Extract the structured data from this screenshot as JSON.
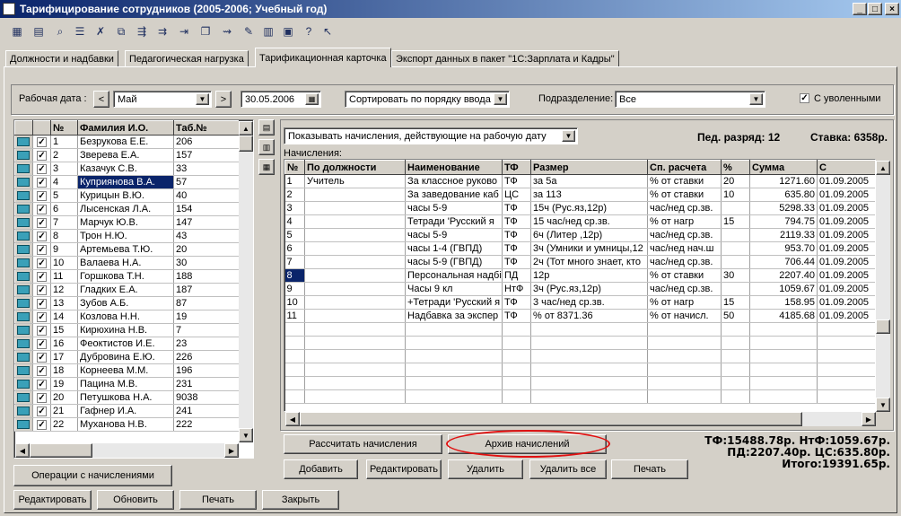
{
  "window": {
    "title": "Тарифицирование сотрудников (2005-2006; Учебный год)"
  },
  "tabs": [
    {
      "label": "Должности и надбавки"
    },
    {
      "label": "Педагогическая нагрузка"
    },
    {
      "label": "Тарификационная карточка"
    },
    {
      "label": "Экспорт данных в пакет \"1С:Зарплата и Кадры\""
    }
  ],
  "filters": {
    "work_date_label": "Рабочая дата :",
    "month": "Май",
    "date": "30.05.2006",
    "sort": "Сортировать по порядку ввода",
    "division_label": "Подразделение:",
    "division": "Все",
    "dismissed_label": "С уволенными",
    "dismissed_mark": "✓"
  },
  "employees": {
    "headers": {
      "num": "№",
      "name": "Фамилия И.О.",
      "tab": "Таб.№"
    },
    "check_mark": "✓",
    "rows": [
      {
        "n": "1",
        "name": "Безрукова Е.Е.",
        "tab": "206"
      },
      {
        "n": "2",
        "name": "Зверева Е.А.",
        "tab": "157"
      },
      {
        "n": "3",
        "name": "Казачук С.В.",
        "tab": "33"
      },
      {
        "n": "4",
        "name": "Куприянова В.А.",
        "tab": "57"
      },
      {
        "n": "5",
        "name": "Курицын В.Ю.",
        "tab": "40"
      },
      {
        "n": "6",
        "name": "Лысенская Л.А.",
        "tab": "154"
      },
      {
        "n": "7",
        "name": "Марчук Ю.В.",
        "tab": "147"
      },
      {
        "n": "8",
        "name": "Трон Н.Ю.",
        "tab": "43"
      },
      {
        "n": "9",
        "name": "Артемьева Т.Ю.",
        "tab": "20"
      },
      {
        "n": "10",
        "name": "Валаева Н.А.",
        "tab": "30"
      },
      {
        "n": "11",
        "name": "Горшкова Т.Н.",
        "tab": "188"
      },
      {
        "n": "12",
        "name": "Гладких Е.А.",
        "tab": "187"
      },
      {
        "n": "13",
        "name": "Зубов А.Б.",
        "tab": "87"
      },
      {
        "n": "14",
        "name": "Козлова Н.Н.",
        "tab": "19"
      },
      {
        "n": "15",
        "name": "Кирюхина Н.В.",
        "tab": "7"
      },
      {
        "n": "16",
        "name": "Феоктистов И.Е.",
        "tab": "23"
      },
      {
        "n": "17",
        "name": "Дубровина Е.Ю.",
        "tab": "226"
      },
      {
        "n": "18",
        "name": "Корнеева М.М.",
        "tab": "196"
      },
      {
        "n": "19",
        "name": "Пацина М.В.",
        "tab": "231"
      },
      {
        "n": "20",
        "name": "Петушкова Н.А.",
        "tab": "9038"
      },
      {
        "n": "21",
        "name": "Гафнер И.А.",
        "tab": "241"
      },
      {
        "n": "22",
        "name": "Муханова Н.В.",
        "tab": "222"
      }
    ]
  },
  "charges_header": {
    "show_filter": "Показывать начисления, действующие на рабочую дату",
    "rank": "Пед. разряд: 12",
    "rate": "Ставка: 6358р.",
    "section_label": "Начисления:"
  },
  "charges": {
    "headers": {
      "n": "№",
      "position": "По должности",
      "name": "Наименование",
      "tf": "ТФ",
      "size": "Размер",
      "method": "Сп. расчета",
      "pct": "%",
      "sum": "Сумма",
      "date": "С"
    },
    "rows": [
      {
        "n": "1",
        "position": "Учитель",
        "name": "За классное руково",
        "tf": "ТФ",
        "size": "за 5а",
        "method": "% от ставки",
        "pct": "20",
        "sum": "1271.60",
        "date": "01.09.2005"
      },
      {
        "n": "2",
        "position": "",
        "name": "За заведование каб",
        "tf": "ЦС",
        "size": "за 113",
        "method": "% от ставки",
        "pct": "10",
        "sum": "635.80",
        "date": "01.09.2005"
      },
      {
        "n": "3",
        "position": "",
        "name": "часы 5-9",
        "tf": "ТФ",
        "size": "15ч (Рус.яз,12р)",
        "method": "час/нед ср.зв.",
        "pct": "",
        "sum": "5298.33",
        "date": "01.09.2005"
      },
      {
        "n": "4",
        "position": "",
        "name": " Тетради 'Русский я",
        "tf": "ТФ",
        "size": "15 час/нед ср.зв.",
        "method": "% от нагр",
        "pct": "15",
        "sum": "794.75",
        "date": "01.09.2005"
      },
      {
        "n": "5",
        "position": "",
        "name": "часы 5-9",
        "tf": "ТФ",
        "size": "6ч (Литер ,12р)",
        "method": "час/нед ср.зв.",
        "pct": "",
        "sum": "2119.33",
        "date": "01.09.2005"
      },
      {
        "n": "6",
        "position": "",
        "name": "часы 1-4 (ГВПД)",
        "tf": "ТФ",
        "size": "3ч (Умники и умницы,12",
        "method": "час/нед нач.ш",
        "pct": "",
        "sum": "953.70",
        "date": "01.09.2005"
      },
      {
        "n": "7",
        "position": "",
        "name": "часы 5-9 (ГВПД)",
        "tf": "ТФ",
        "size": "2ч (Тот много знает, кто",
        "method": "час/нед ср.зв.",
        "pct": "",
        "sum": "706.44",
        "date": "01.09.2005"
      },
      {
        "n": "8",
        "position": "",
        "name": "Персональная надбі",
        "tf": "ПД",
        "size": "12р",
        "method": "% от ставки",
        "pct": "30",
        "sum": "2207.40",
        "date": "01.09.2005"
      },
      {
        "n": "9",
        "position": "",
        "name": "Часы 9 кл",
        "tf": "НтФ",
        "size": "3ч (Рус.яз,12р)",
        "method": "час/нед ср.зв.",
        "pct": "",
        "sum": "1059.67",
        "date": "01.09.2005"
      },
      {
        "n": "10",
        "position": "",
        "name": "+Тетради 'Русский я",
        "tf": "ТФ",
        "size": "3 час/нед ср.зв.",
        "method": "% от нагр",
        "pct": "15",
        "sum": "158.95",
        "date": "01.09.2005"
      },
      {
        "n": "11",
        "position": "",
        "name": "Надбавка за экспер",
        "tf": "ТФ",
        "size": "% от 8371.36",
        "method": "% от начисл.",
        "pct": "50",
        "sum": "4185.68",
        "date": "01.09.2005"
      }
    ]
  },
  "buttons": {
    "calc": "Рассчитать начисления",
    "archive": "Архив начислений",
    "add": "Добавить",
    "edit": "Редактировать",
    "delete": "Удалить",
    "delete_all": "Удалить все",
    "print": "Печать",
    "operations": "Операции с начислениями",
    "edit_bottom": "Редактировать",
    "refresh": "Обновить",
    "print_bottom": "Печать",
    "close": "Закрыть"
  },
  "totals": {
    "line1": "ТФ:15488.78р. НтФ:1059.67р.",
    "line2": "ПД:2207.40р. ЦС:635.80р.",
    "line3": "Итого:19391.65р."
  },
  "colors": {
    "accent": "#0a246a",
    "highlight_oval": "#e01010",
    "folder": "#3aa0b8"
  }
}
